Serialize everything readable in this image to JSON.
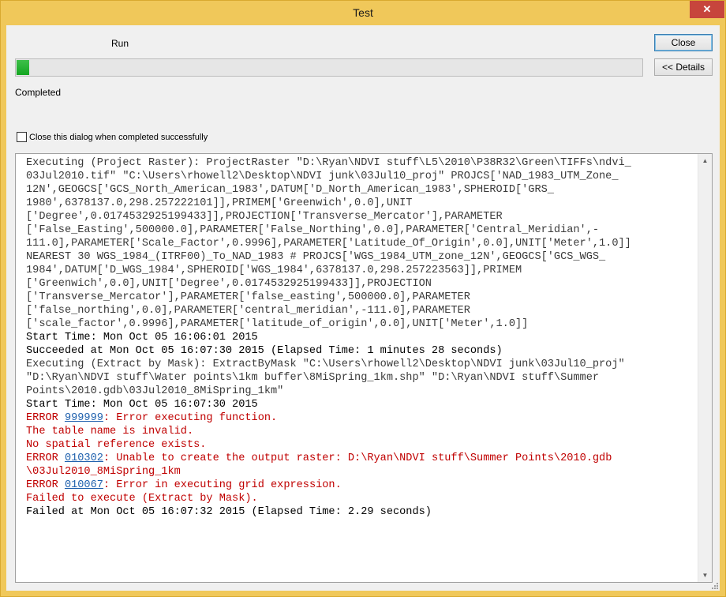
{
  "window": {
    "title": "Test"
  },
  "dialog": {
    "step_label": "Run",
    "progress": 0.02,
    "status": "Completed",
    "buttons": {
      "close": "Close",
      "details": "<< Details"
    },
    "checkbox": {
      "label": "Close this dialog when completed successfully",
      "checked": false
    }
  },
  "log": {
    "lines": [
      {
        "style": "info",
        "text": "Executing (Project Raster): ProjectRaster \"D:\\Ryan\\NDVI stuff\\L5\\2010\\P38R32\\Green\\TIFFs\\ndvi_"
      },
      {
        "style": "info",
        "text": "03Jul2010.tif\" \"C:\\Users\\rhowell2\\Desktop\\NDVI junk\\03Jul10_proj\" PROJCS['NAD_1983_UTM_Zone_"
      },
      {
        "style": "info",
        "text": "12N',GEOGCS['GCS_North_American_1983',DATUM['D_North_American_1983',SPHEROID['GRS_"
      },
      {
        "style": "info",
        "text": "1980',6378137.0,298.257222101]],PRIMEM['Greenwich',0.0],UNIT"
      },
      {
        "style": "info",
        "text": "['Degree',0.0174532925199433]],PROJECTION['Transverse_Mercator'],PARAMETER"
      },
      {
        "style": "info",
        "text": "['False_Easting',500000.0],PARAMETER['False_Northing',0.0],PARAMETER['Central_Meridian',-"
      },
      {
        "style": "info",
        "text": "111.0],PARAMETER['Scale_Factor',0.9996],PARAMETER['Latitude_Of_Origin',0.0],UNIT['Meter',1.0]]"
      },
      {
        "style": "info",
        "text": "NEAREST 30 WGS_1984_(ITRF00)_To_NAD_1983 # PROJCS['WGS_1984_UTM_zone_12N',GEOGCS['GCS_WGS_"
      },
      {
        "style": "info",
        "text": "1984',DATUM['D_WGS_1984',SPHEROID['WGS_1984',6378137.0,298.257223563]],PRIMEM"
      },
      {
        "style": "info",
        "text": "['Greenwich',0.0],UNIT['Degree',0.0174532925199433]],PROJECTION"
      },
      {
        "style": "info",
        "text": "['Transverse_Mercator'],PARAMETER['false_easting',500000.0],PARAMETER"
      },
      {
        "style": "info",
        "text": "['false_northing',0.0],PARAMETER['central_meridian',-111.0],PARAMETER"
      },
      {
        "style": "info",
        "text": "['scale_factor',0.9996],PARAMETER['latitude_of_origin',0.0],UNIT['Meter',1.0]]"
      },
      {
        "style": "ok",
        "text": "Start Time: Mon Oct 05 16:06:01 2015"
      },
      {
        "style": "ok",
        "text": "Succeeded at Mon Oct 05 16:07:30 2015 (Elapsed Time: 1 minutes 28 seconds)"
      },
      {
        "style": "info",
        "text": "Executing (Extract by Mask): ExtractByMask \"C:\\Users\\rhowell2\\Desktop\\NDVI junk\\03Jul10_proj\""
      },
      {
        "style": "info",
        "text": "\"D:\\Ryan\\NDVI stuff\\Water points\\1km buffer\\8MiSpring_1km.shp\" \"D:\\Ryan\\NDVI stuff\\Summer"
      },
      {
        "style": "info",
        "text": "Points\\2010.gdb\\03Jul2010_8MiSpring_1km\""
      },
      {
        "style": "ok",
        "text": "Start Time: Mon Oct 05 16:07:30 2015"
      },
      {
        "style": "err",
        "prefix": "ERROR ",
        "link": "999999",
        "text": ": Error executing function."
      },
      {
        "style": "err",
        "text": "The table name is invalid."
      },
      {
        "style": "err",
        "text": "No spatial reference exists."
      },
      {
        "style": "err",
        "prefix": "ERROR ",
        "link": "010302",
        "text": ": Unable to create the output raster: D:\\Ryan\\NDVI stuff\\Summer Points\\2010.gdb"
      },
      {
        "style": "err",
        "text": "\\03Jul2010_8MiSpring_1km"
      },
      {
        "style": "err",
        "prefix": "ERROR ",
        "link": "010067",
        "text": ": Error in executing grid expression."
      },
      {
        "style": "err",
        "text": "Failed to execute (Extract by Mask)."
      },
      {
        "style": "ok",
        "text": "Failed at Mon Oct 05 16:07:32 2015 (Elapsed Time: 2.29 seconds)"
      }
    ]
  },
  "colors": {
    "title_accent": "#f0c85a",
    "error": "#c00000",
    "link": "#1e60ad",
    "progress": "#2bb33a"
  },
  "icons": {
    "close": "close-icon",
    "scroll_up": "scroll-up-icon",
    "scroll_down": "scroll-down-icon",
    "resize": "resize-grip-icon"
  }
}
